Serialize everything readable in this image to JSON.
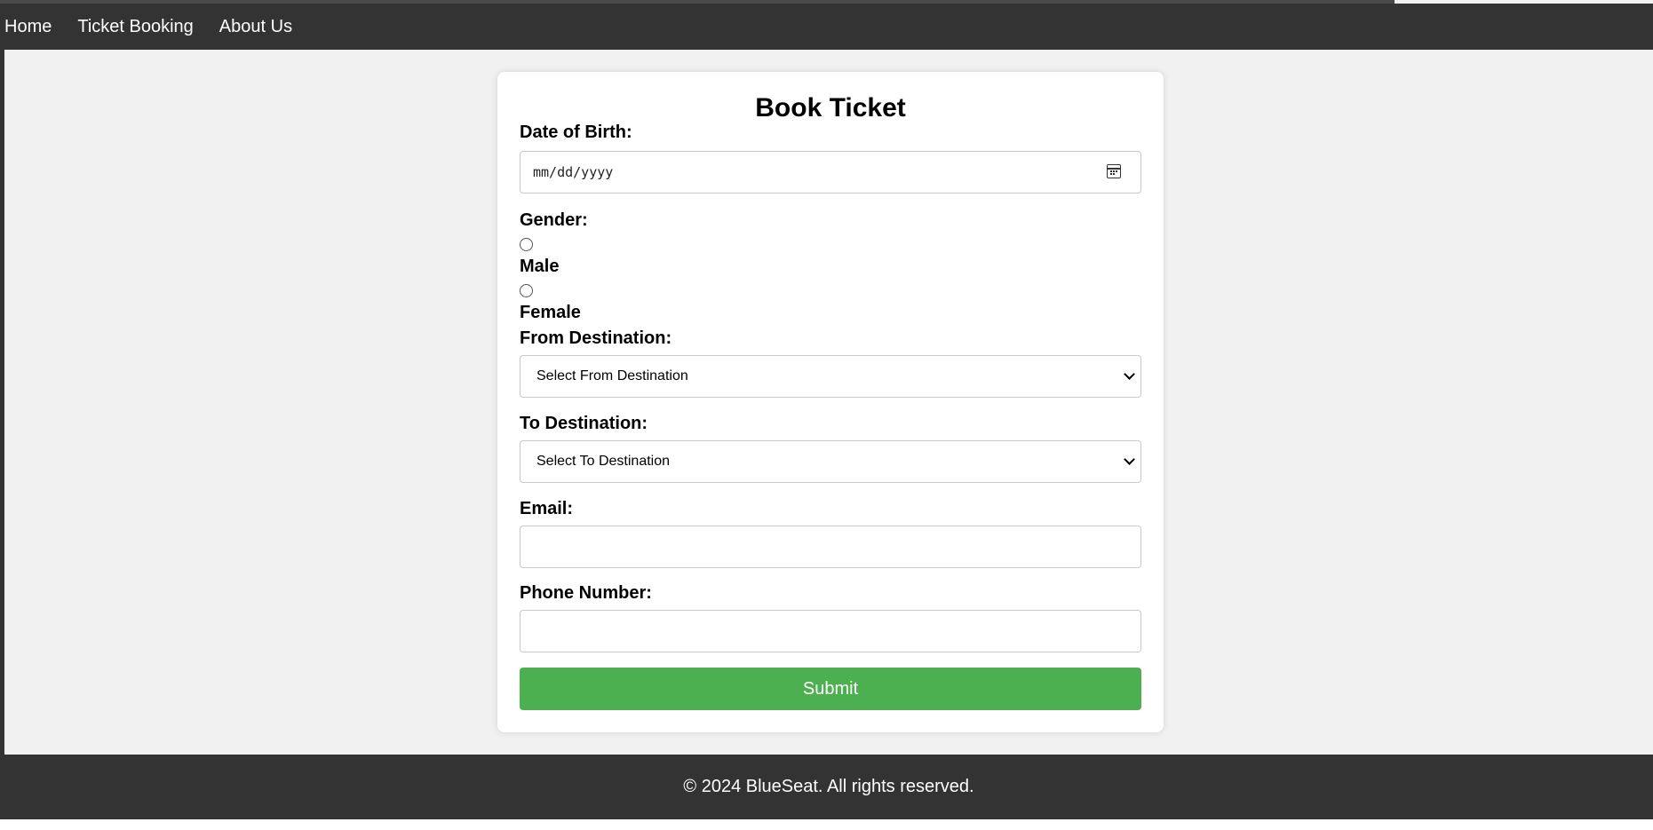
{
  "nav": {
    "links": [
      "Home",
      "Ticket Booking",
      "About Us"
    ]
  },
  "form": {
    "title": "Book Ticket",
    "dob_label": "Date of Birth:",
    "dob_placeholder": "mm/dd/yyyy",
    "gender_label": "Gender:",
    "gender_options": [
      "Male",
      "Female"
    ],
    "from_label": "From Destination:",
    "from_selected": "Select From Destination",
    "to_label": "To Destination:",
    "to_selected": "Select To Destination",
    "email_label": "Email:",
    "email_value": "",
    "phone_label": "Phone Number:",
    "phone_value": "",
    "submit_label": "Submit"
  },
  "footer": {
    "text": "© 2024 BlueSeat. All rights reserved."
  },
  "colors": {
    "nav_bg": "#333333",
    "page_bg": "#f1f1f1",
    "submit_bg": "#4caf50"
  },
  "icons": {
    "date": "calendar-icon",
    "select": "chevron-down-icon"
  }
}
